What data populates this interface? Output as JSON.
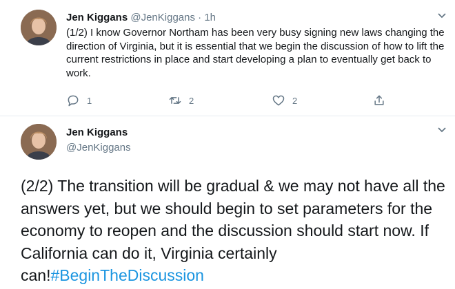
{
  "tweet1": {
    "author_name": "Jen Kiggans",
    "author_handle": "@JenKiggans",
    "separator": " · ",
    "timestamp": "1h",
    "text": "(1/2) I know Governor Northam has been very busy signing new laws changing the direction of Virginia, but it is essential that we begin the discussion of how to lift the current restrictions in place and start developing a plan to eventually get back to work.",
    "actions": {
      "reply_count": "1",
      "retweet_count": "2",
      "like_count": "2"
    }
  },
  "tweet2": {
    "author_name": "Jen Kiggans",
    "author_handle": "@JenKiggans",
    "text": "(2/2) The transition will be gradual & we may not have all the answers yet, but we should begin to set parameters for the economy to reopen and the discussion should start now. If California can do it, Virginia certainly can!",
    "hashtag": "#BeginTheDiscussion"
  },
  "colors": {
    "text": "#14171a",
    "secondary": "#657786",
    "link": "#1b95e0",
    "divider": "#e6ecf0"
  },
  "icons": [
    "avatar",
    "chevron-down-icon",
    "reply-icon",
    "retweet-icon",
    "like-icon",
    "share-icon"
  ]
}
